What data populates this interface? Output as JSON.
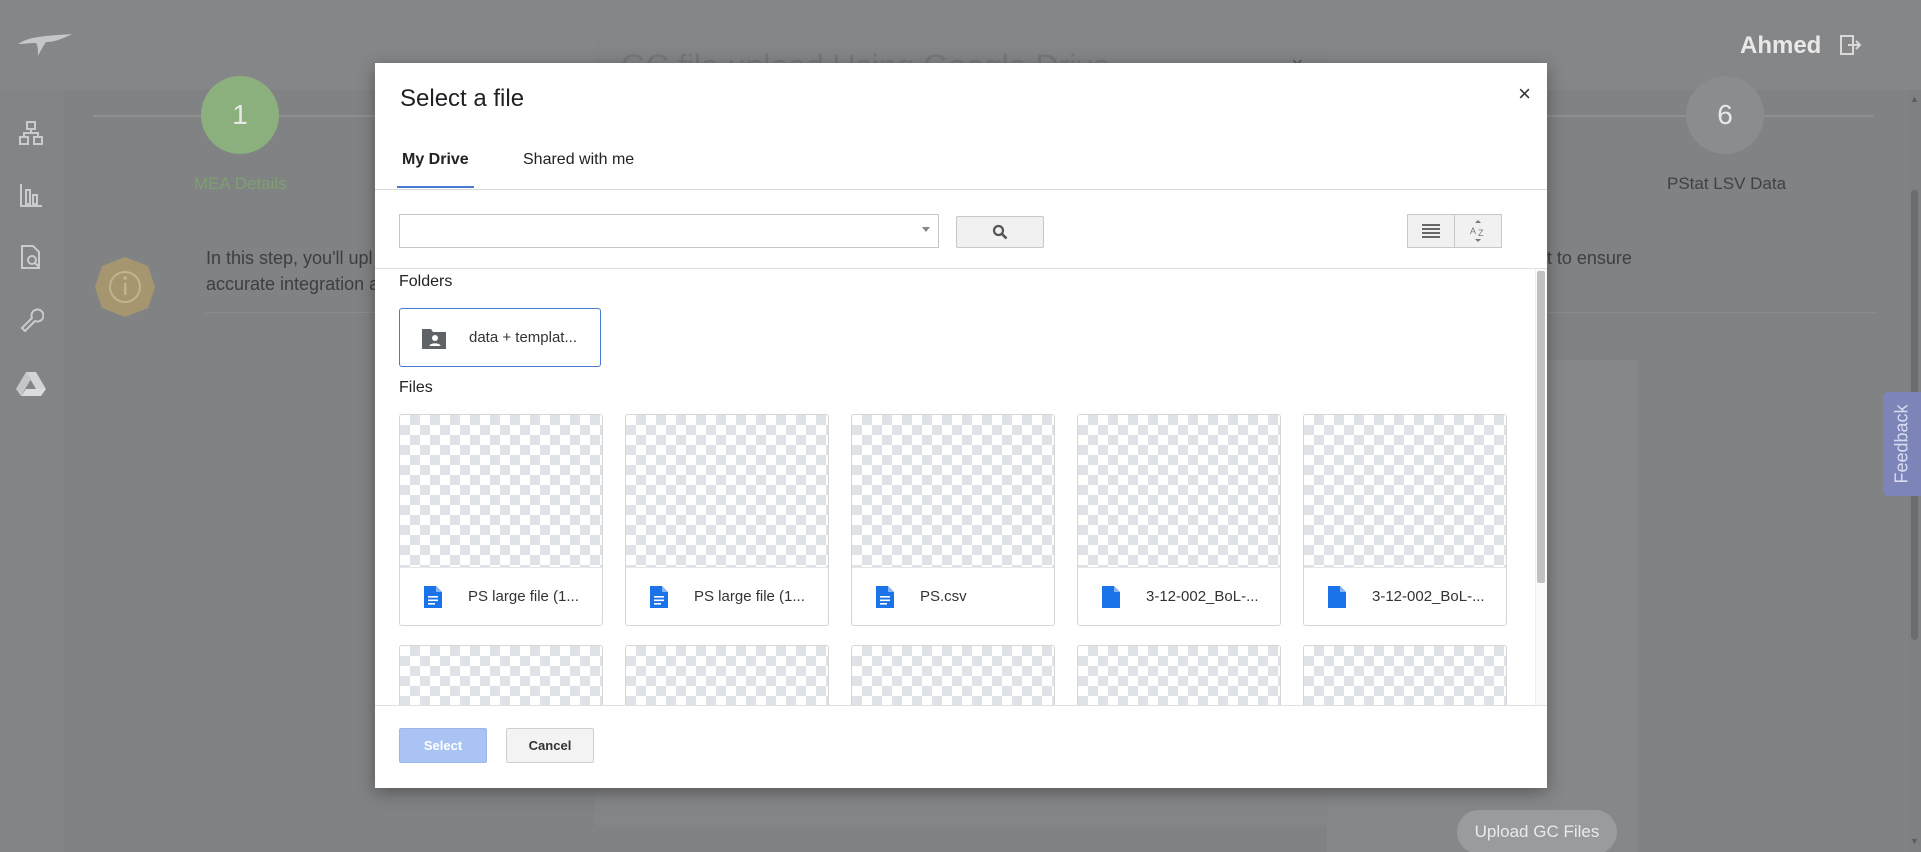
{
  "app": {
    "user_name": "Ahmed",
    "info_text": "In this step, you'll upl                                                                                                                                                                                              ovided in the required format to ensure",
    "info_text_line2": "accurate integration a",
    "upload_gc_label": "Upload GC Files",
    "feedback_label": "Feedback",
    "steps": [
      {
        "number": "1",
        "label": "MEA Details",
        "state": "done",
        "color": "#8bb07e"
      },
      {
        "number": "6",
        "label": "PStat LSV Data",
        "state": "pending",
        "color": "#8a8c8e"
      }
    ]
  },
  "underlying_dialog": {
    "title": "GC file upload Using Google Drive",
    "close_label": "×"
  },
  "picker": {
    "title": "Select a file",
    "close_label": "×",
    "tabs": [
      {
        "label": "My Drive",
        "active": true
      },
      {
        "label": "Shared with me",
        "active": false
      }
    ],
    "search": {
      "value": "",
      "placeholder": ""
    },
    "sections": {
      "folders_label": "Folders",
      "files_label": "Files"
    },
    "folders": [
      {
        "name": "data + templat...",
        "icon": "shared-folder-icon"
      }
    ],
    "files": [
      {
        "name": "PS large file (1...",
        "icon": "google-doc-icon"
      },
      {
        "name": "PS large file (1...",
        "icon": "google-doc-icon"
      },
      {
        "name": "PS.csv",
        "icon": "google-doc-icon"
      },
      {
        "name": "3-12-002_BoL-...",
        "icon": "file-icon"
      },
      {
        "name": "3-12-002_BoL-...",
        "icon": "file-icon"
      }
    ],
    "select_label": "Select",
    "cancel_label": "Cancel",
    "accent_color": "#4a7bd0",
    "file_icon_color": "#1a73e8"
  }
}
